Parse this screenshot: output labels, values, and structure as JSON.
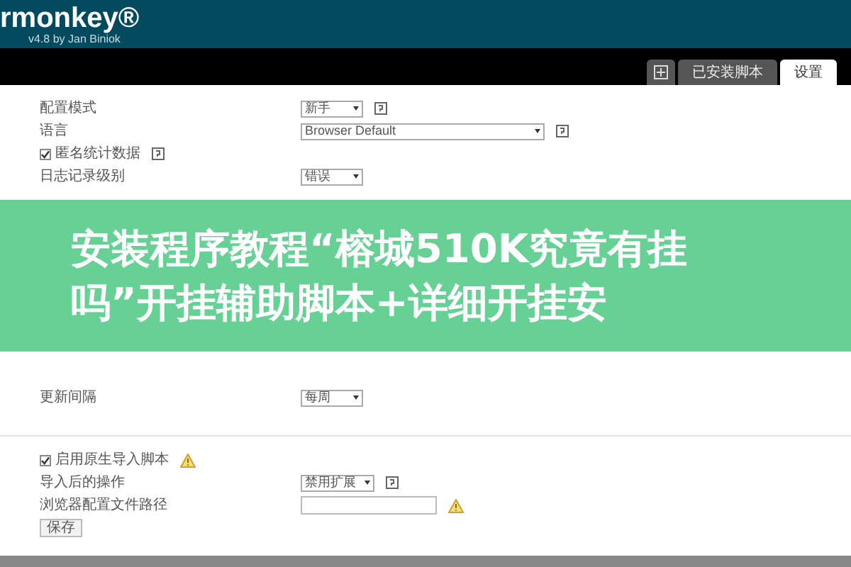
{
  "header": {
    "logo": "rmonkey®",
    "version": "v4.8 by Jan Biniok"
  },
  "tabs": [
    {
      "kind": "icon",
      "selected": false
    },
    {
      "kind": "text",
      "label": "已安装脚本",
      "selected": false
    },
    {
      "kind": "text",
      "label": "设置",
      "selected": true
    }
  ],
  "sections": [
    {
      "rows": [
        {
          "kind": "dropdown",
          "label": "配置模式",
          "value": "新手",
          "help": true
        },
        {
          "kind": "wide-dropdown",
          "label": "语言",
          "value": "Browser Default",
          "help": true
        },
        {
          "kind": "checkbox",
          "label": "匿名统计数据",
          "checked": true,
          "help": true
        },
        {
          "kind": "dropdown",
          "label": "日志记录级别",
          "value": "错误"
        }
      ]
    },
    {
      "rows": [
        {
          "kind": "dropdown",
          "label": "更新间隔",
          "value": "每周"
        }
      ]
    },
    {
      "rows": [
        {
          "kind": "checkbox",
          "label": "启用原生导入脚本",
          "checked": true,
          "warning": true
        },
        {
          "kind": "dropdown",
          "label": "导入后的操作",
          "value": "禁用扩展",
          "help": true
        },
        {
          "kind": "input",
          "label": "浏览器配置文件路径",
          "warning": true
        },
        {
          "kind": "button",
          "label": "保存"
        }
      ]
    }
  ],
  "overlay_caption": "安装程序教程“榕城510K究竟有挂吗”开挂辅助脚本+详细开挂安"
}
